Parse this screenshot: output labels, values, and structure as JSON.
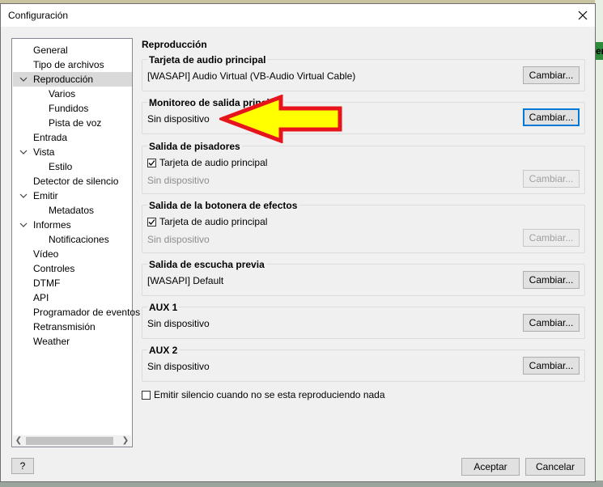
{
  "window": {
    "title": "Configuración"
  },
  "background": {
    "edge_text": "en"
  },
  "tree": {
    "items": [
      {
        "label": "General",
        "level": 0,
        "expander": ""
      },
      {
        "label": "Tipo de archivos",
        "level": 0,
        "expander": ""
      },
      {
        "label": "Reproducción",
        "level": 0,
        "expander": "expanded",
        "selected": true
      },
      {
        "label": "Varios",
        "level": 1,
        "expander": ""
      },
      {
        "label": "Fundidos",
        "level": 1,
        "expander": ""
      },
      {
        "label": "Pista de voz",
        "level": 1,
        "expander": ""
      },
      {
        "label": "Entrada",
        "level": 0,
        "expander": ""
      },
      {
        "label": "Vista",
        "level": 0,
        "expander": "expanded"
      },
      {
        "label": "Estilo",
        "level": 1,
        "expander": ""
      },
      {
        "label": "Detector de silencio",
        "level": 0,
        "expander": ""
      },
      {
        "label": "Emitir",
        "level": 0,
        "expander": "expanded"
      },
      {
        "label": "Metadatos",
        "level": 1,
        "expander": ""
      },
      {
        "label": "Informes",
        "level": 0,
        "expander": "expanded"
      },
      {
        "label": "Notificaciones",
        "level": 1,
        "expander": ""
      },
      {
        "label": "Vídeo",
        "level": 0,
        "expander": ""
      },
      {
        "label": "Controles",
        "level": 0,
        "expander": ""
      },
      {
        "label": "DTMF",
        "level": 0,
        "expander": ""
      },
      {
        "label": "API",
        "level": 0,
        "expander": ""
      },
      {
        "label": "Programador de eventos",
        "level": 0,
        "expander": ""
      },
      {
        "label": "Retransmisión",
        "level": 0,
        "expander": ""
      },
      {
        "label": "Weather",
        "level": 0,
        "expander": ""
      }
    ]
  },
  "panel": {
    "title": "Reproducción",
    "groups": [
      {
        "title": "Tarjeta de audio principal",
        "device": "[WASAPI] Audio Virtual (VB-Audio Virtual Cable)",
        "button": "Cambiar...",
        "disabled": false
      },
      {
        "title": "Monitoreo de salida principal",
        "device": "Sin dispositivo",
        "button": "Cambiar...",
        "disabled": false,
        "focused": true
      },
      {
        "title": "Salida de pisadores",
        "checkbox_label": "Tarjeta de audio principal",
        "checked": true,
        "device": "Sin dispositivo",
        "button": "Cambiar...",
        "disabled": true
      },
      {
        "title": "Salida de la botonera de efectos",
        "checkbox_label": "Tarjeta de audio principal",
        "checked": true,
        "device": "Sin dispositivo",
        "button": "Cambiar...",
        "disabled": true
      },
      {
        "title": "Salida de escucha previa",
        "device": "[WASAPI] Default",
        "button": "Cambiar...",
        "disabled": false
      },
      {
        "title": "AUX 1",
        "device": "Sin dispositivo",
        "button": "Cambiar...",
        "disabled": false
      },
      {
        "title": "AUX 2",
        "device": "Sin dispositivo",
        "button": "Cambiar...",
        "disabled": false
      }
    ],
    "silence_checkbox": {
      "label": "Emitir silencio cuando no se esta reproduciendo nada",
      "checked": false
    }
  },
  "footer": {
    "help_label": "?",
    "ok_label": "Aceptar",
    "cancel_label": "Cancelar"
  },
  "annotation": {
    "arrow_fill": "#ffff00",
    "arrow_stroke": "#e8141c"
  }
}
